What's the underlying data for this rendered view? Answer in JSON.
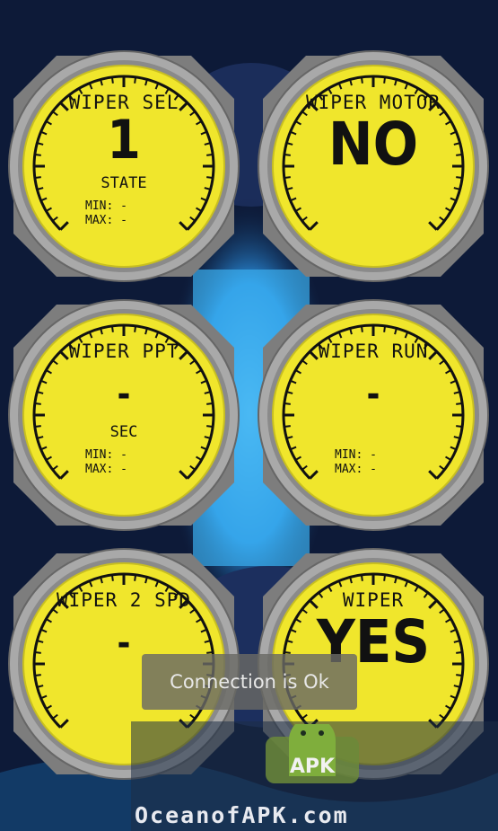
{
  "gauges": [
    {
      "title": "WIPER SEL",
      "value": "1",
      "unit": "STATE",
      "min": "MIN: -",
      "max": "MAX: -",
      "style": "normal"
    },
    {
      "title": "WIPER MOTOR",
      "value": "NO",
      "unit": "",
      "min": "",
      "max": "",
      "style": "big"
    },
    {
      "title": "WIPER PPT",
      "value": "-",
      "unit": "SEC",
      "min": "MIN: -",
      "max": "MAX: -",
      "style": "dash"
    },
    {
      "title": "WIPER RUN",
      "value": "-",
      "unit": "",
      "min": "MIN: -",
      "max": "MAX: -",
      "style": "dash"
    },
    {
      "title": "WIPER 2 SPD",
      "value": "-",
      "unit": "",
      "min": "",
      "max": "",
      "style": "dash"
    },
    {
      "title": "WIPER",
      "value": "YES",
      "unit": "",
      "min": "",
      "max": "",
      "style": "big"
    }
  ],
  "toast": {
    "text": "Connection is Ok"
  },
  "watermark": {
    "text": "OceanofAPK.com",
    "logo": "APK"
  },
  "colors": {
    "face": "#f0e62c",
    "bezel": "#8e8e8e",
    "background": "#0e1a36",
    "accent": "#2ea8f0"
  }
}
